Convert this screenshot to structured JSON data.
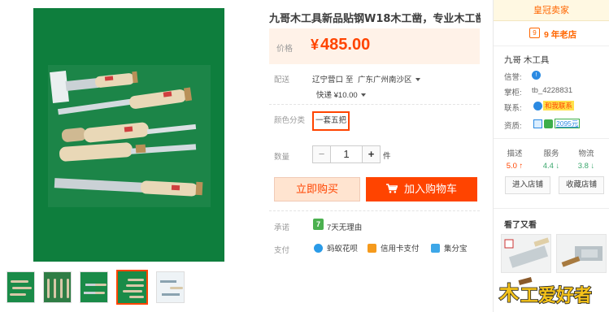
{
  "product": {
    "title": "九哥木工具新品贴钢W18木工凿，专业木工凿",
    "price_label": "价格",
    "price_symbol": "¥",
    "price": "485.00",
    "shipping": {
      "label": "配送",
      "from": "辽宁营口",
      "to_word": "至",
      "to": "广东广州南沙区",
      "method": "快递 ¥10.00"
    },
    "sku": {
      "label": "颜色分类",
      "option": "一套五把"
    },
    "quantity": {
      "label": "数量",
      "minus": "−",
      "value": "1",
      "plus": "+",
      "unit": "件"
    },
    "buy_now": "立即购买",
    "add_to_cart": "加入购物车",
    "promise": {
      "label": "承诺",
      "icon_text": "7",
      "text": "7天无理由"
    },
    "payment": {
      "label": "支付",
      "methods": [
        "蚂蚁花呗",
        "信用卡支付",
        "集分宝"
      ]
    }
  },
  "shop": {
    "header": "皇冠卖家",
    "age_icon": "9",
    "age": "9 年老店",
    "name": "九哥 木工具",
    "credit_label": "信誉:",
    "keeper_label": "掌柜:",
    "keeper": "tb_4228831",
    "contact_label": "联系:",
    "contact_text": "和我联系",
    "qualification_label": "资质:",
    "qualification_value": "2095元",
    "scores": [
      {
        "label": "描述",
        "value": "5.0",
        "trend": "up"
      },
      {
        "label": "服务",
        "value": "4.4",
        "trend": "down"
      },
      {
        "label": "物流",
        "value": "3.8",
        "trend": "down"
      }
    ],
    "enter_shop": "进入店铺",
    "favorite_shop": "收藏店铺",
    "seen_title": "看了又看"
  },
  "colors": {
    "accent": "#ff4400",
    "price_bg": "#fff2e8",
    "photo_bg": "#0e7e3d"
  },
  "icons": [
    "cart-icon",
    "credit-icon",
    "wangwang-icon",
    "huabei-icon",
    "credit-card-icon",
    "jifenbao-icon",
    "promise-icon"
  ]
}
